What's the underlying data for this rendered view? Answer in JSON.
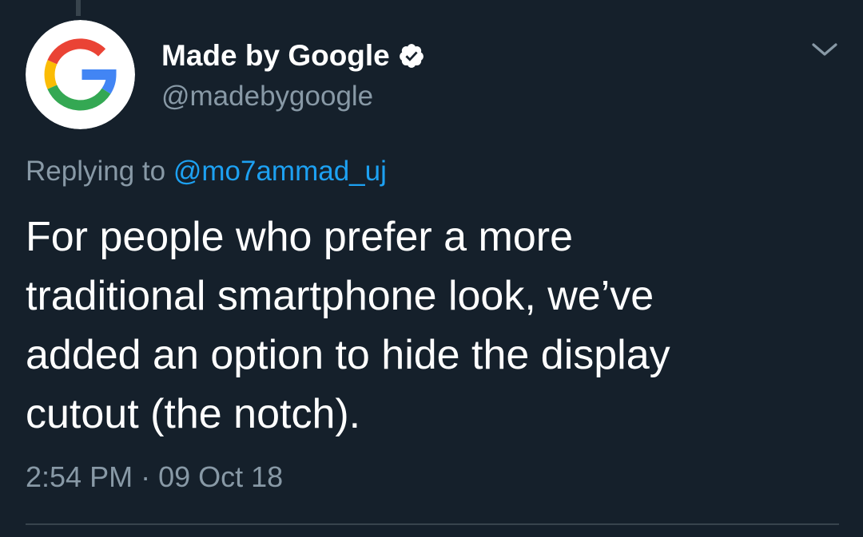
{
  "tweet": {
    "author": {
      "display_name": "Made by Google",
      "handle": "@madebygoogle",
      "verified": true,
      "avatar_icon": "google-g-logo-icon"
    },
    "reply": {
      "prefix": "Replying to",
      "mention": "@mo7ammad_uj"
    },
    "text_lines": [
      "For people who prefer a more",
      "traditional smartphone look, we’ve",
      "added an option to hide the display",
      "cutout (the notch)."
    ],
    "time": "2:54 PM",
    "separator": "·",
    "date": "09 Oct 18",
    "menu_icon": "chevron-down-icon"
  },
  "colors": {
    "background": "#15202b",
    "primary_text": "#ffffff",
    "secondary_text": "#8899a6",
    "accent": "#1da1f2",
    "divider": "#38444d"
  }
}
